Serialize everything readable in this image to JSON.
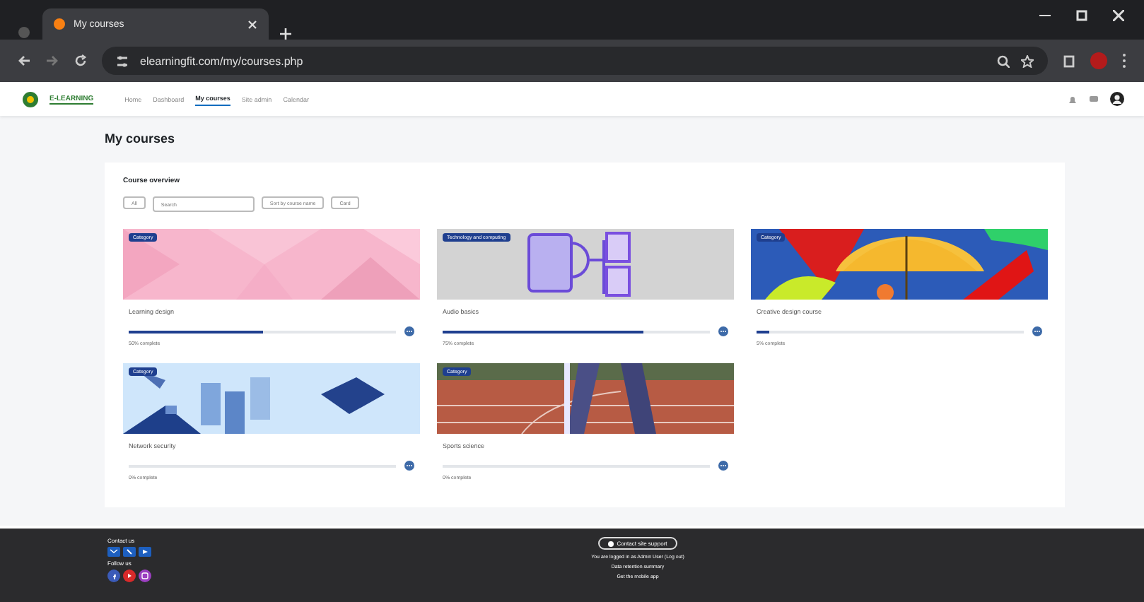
{
  "browser": {
    "tab_title": "My courses",
    "url": "elearningfit.com/my/courses.php"
  },
  "navbar": {
    "logo_text": "E-LEARNING",
    "items": [
      {
        "label": "Home",
        "selected": false
      },
      {
        "label": "Dashboard",
        "selected": false
      },
      {
        "label": "My courses",
        "selected": true
      },
      {
        "label": "Site admin",
        "selected": false
      },
      {
        "label": "Calendar",
        "selected": false
      }
    ]
  },
  "page_title": "My courses",
  "overview": {
    "heading": "Course overview",
    "filter": "All",
    "search": {
      "placeholder": "Search"
    },
    "sort": "Sort by course name",
    "view": "Card",
    "courses": [
      {
        "category": "Category",
        "name": "Learning design",
        "level": 0.5,
        "progress_text": "50% complete"
      },
      {
        "category": "Technology and computing",
        "name": "Audio basics",
        "level": 0.75,
        "progress_text": "75% complete"
      },
      {
        "category": "Category",
        "name": "Creative design course",
        "level": 0.05,
        "progress_text": "5% complete"
      },
      {
        "category": "Category",
        "name": "Network security",
        "level": 0,
        "progress_text": "0% complete"
      },
      {
        "category": "Category",
        "name": "Sports science",
        "level": 0,
        "progress_text": "0% complete"
      }
    ]
  },
  "footer": {
    "contact_heading": "Contact us",
    "follow_heading": "Follow us",
    "support_button": "Contact site support",
    "logged_in": "You are logged in as Admin User (Log out)",
    "data_retention": "Data retention summary",
    "mobile_app": "Get the mobile app"
  }
}
